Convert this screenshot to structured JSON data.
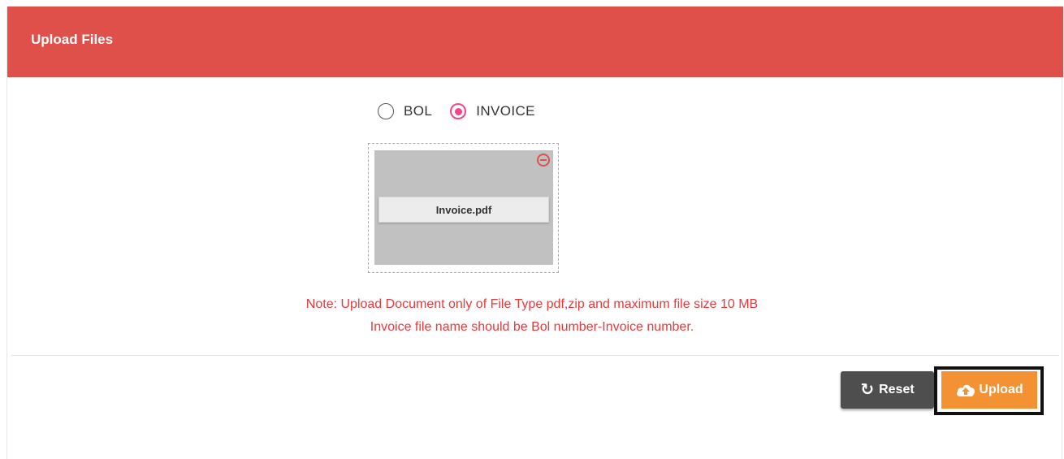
{
  "panel": {
    "title": "Upload Files",
    "header_color": "#e0504b"
  },
  "document_type": {
    "options": [
      {
        "label": "BOL",
        "selected": false
      },
      {
        "label": "INVOICE",
        "selected": true
      }
    ],
    "accent_color": "#f4448a"
  },
  "dropzone": {
    "file": {
      "name": "Invoice.pdf",
      "remove_icon": "minus-circle-icon"
    }
  },
  "notes": {
    "line1": "Note: Upload Document only of File Type pdf,zip and maximum file size 10 MB",
    "line2": "Invoice file name should be Bol number-Invoice number.",
    "color": "#e8393b"
  },
  "actions": {
    "reset_label": "Reset",
    "reset_icon": "refresh-icon",
    "upload_label": "Upload",
    "upload_icon": "cloud-upload-icon",
    "upload_color": "#f39233"
  }
}
